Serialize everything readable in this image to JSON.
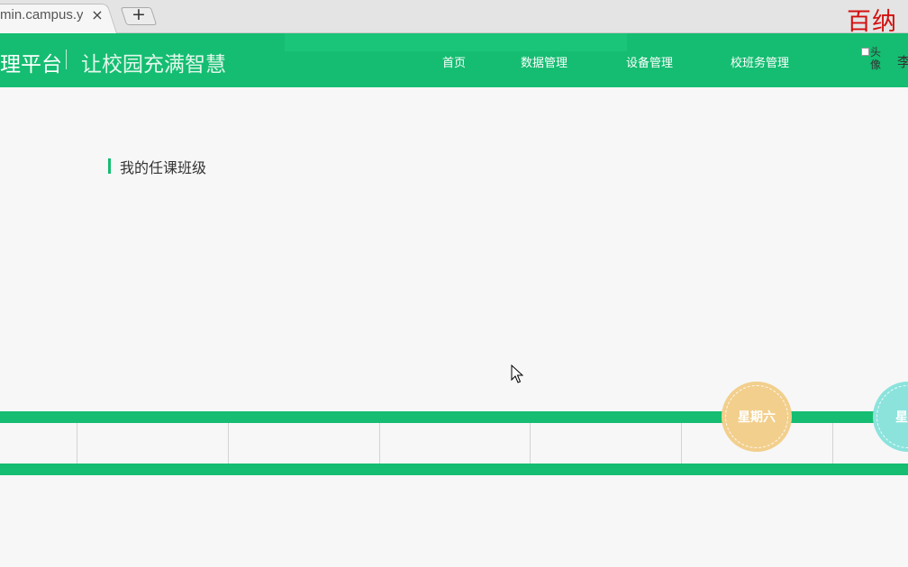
{
  "browser": {
    "tab_title": "min.campus.y",
    "tab_close_glyph": "×",
    "new_tab_glyph": "+"
  },
  "watermark": "百纳",
  "header": {
    "brand": "理平台",
    "slogan": "让校园充满智慧",
    "nav": [
      "首页",
      "数据管理",
      "设备管理",
      "校班务管理"
    ],
    "avatar_alt": "头像",
    "user_name": "李"
  },
  "section": {
    "title": "我的任课班级"
  },
  "week": {
    "days": [
      {
        "label": "星期六",
        "color": "#f2cf8c"
      },
      {
        "label": "星期",
        "color": "#8be3dc"
      }
    ]
  },
  "colors": {
    "brand_green": "#14bd71",
    "page_bg": "#f7f7f7"
  }
}
